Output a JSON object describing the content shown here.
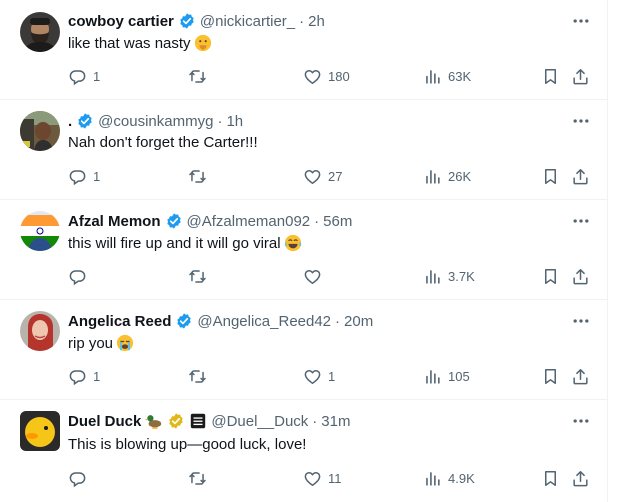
{
  "replies": [
    {
      "name": "cowboy cartier",
      "handle": "@nickicartier_",
      "separator": "·",
      "time": "2h",
      "text": "like that was nasty",
      "emoji": "face-with-hand-over-mouth-emoji",
      "replies": "1",
      "retweets": "",
      "likes": "180",
      "views": "63K",
      "avatar": "bearded-man-avatar"
    },
    {
      "name": ".",
      "handle": "@cousinkammyg",
      "separator": "·",
      "time": "1h",
      "text": "Nah don't forget the Carter!!!",
      "emoji": "",
      "replies": "1",
      "retweets": "",
      "likes": "27",
      "views": "26K",
      "avatar": "person-in-car-avatar"
    },
    {
      "name": "Afzal Memon",
      "handle": "@Afzalmeman092",
      "separator": "·",
      "time": "56m",
      "text": "this will fire up and it will go viral",
      "emoji": "face-with-tears-of-joy-emoji",
      "replies": "",
      "retweets": "",
      "likes": "",
      "views": "3.7K",
      "avatar": "flag-avatar"
    },
    {
      "name": "Angelica Reed",
      "handle": "@Angelica_Reed42",
      "separator": "·",
      "time": "20m",
      "text": "rip you",
      "emoji": "loudly-crying-face-emoji",
      "replies": "1",
      "retweets": "",
      "likes": "1",
      "views": "105",
      "avatar": "red-hair-woman-avatar"
    },
    {
      "name": "Duel Duck",
      "handle": "@Duel__Duck",
      "separator": "·",
      "time": "31m",
      "text": "This is blowing up—good luck, love!",
      "emoji": "",
      "replies": "",
      "retweets": "",
      "likes": "11",
      "views": "4.9K",
      "avatar": "yellow-duck-avatar"
    }
  ],
  "colors": {
    "verified_blue": "#1d9bf0",
    "verified_gold": "#e2b719",
    "text_primary": "#0f1419",
    "text_secondary": "#536471",
    "divider": "#eff3f4"
  },
  "icons": {
    "reply": "reply-icon",
    "retweet": "retweet-icon",
    "like": "heart-icon",
    "views": "views-chart-icon",
    "bookmark": "bookmark-icon",
    "share": "share-icon",
    "more": "more-dots-icon"
  }
}
